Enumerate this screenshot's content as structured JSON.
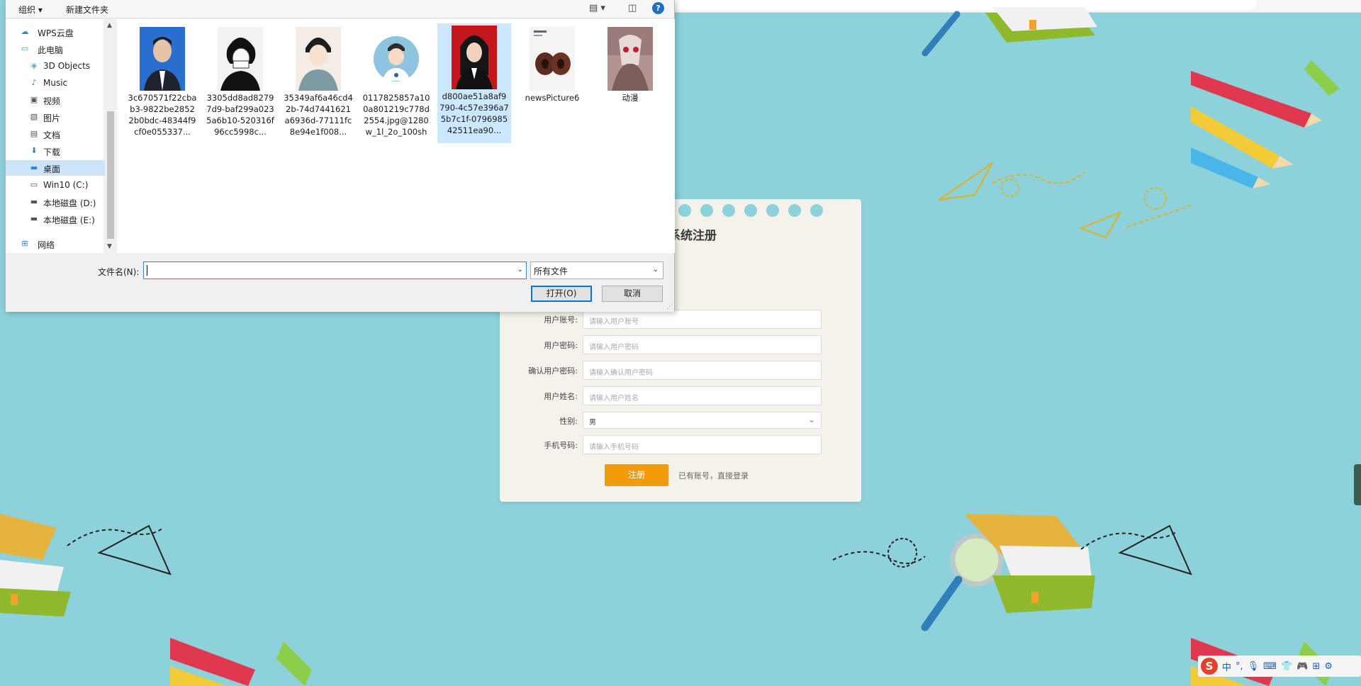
{
  "dialog": {
    "toolbar": {
      "organize_label": "组织 ▾",
      "new_folder_label": "新建文件夹",
      "view_icon": "view-options-icon",
      "pane_icon": "preview-pane-icon",
      "help_label": "?"
    },
    "nav": [
      {
        "label": "WPS云盘",
        "icon": "cloud-icon"
      },
      {
        "label": "此电脑",
        "icon": "computer-icon"
      },
      {
        "label": "3D Objects",
        "icon": "3d-objects-icon"
      },
      {
        "label": "Music",
        "icon": "music-icon"
      },
      {
        "label": "视频",
        "icon": "video-icon"
      },
      {
        "label": "图片",
        "icon": "pictures-icon"
      },
      {
        "label": "文档",
        "icon": "documents-icon"
      },
      {
        "label": "下载",
        "icon": "download-icon"
      },
      {
        "label": "桌面",
        "icon": "desktop-icon"
      },
      {
        "label": "Win10 (C:)",
        "icon": "drive-icon"
      },
      {
        "label": "本地磁盘 (D:)",
        "icon": "drive-icon"
      },
      {
        "label": "本地磁盘 (E:)",
        "icon": "drive-icon"
      },
      {
        "label": "网络",
        "icon": "network-icon"
      }
    ],
    "files": [
      {
        "name": "3c670571f22cbab3-9822be28522b0bdc-48344f9cf0e055337..."
      },
      {
        "name": "3305dd8ad82797d9-baf299a0235a6b10-520316f96cc5998c..."
      },
      {
        "name": "35349af6a46cd42b-74d7441621a6936d-77111fc8e94e1f008..."
      },
      {
        "name": "0117825857a100a801219c778d2554.jpg@1280w_1l_2o_100sh"
      },
      {
        "name": "d800ae51a8af9790-4c57e396a75b7c1f-079698542511ea90..."
      },
      {
        "name": "newsPicture6"
      },
      {
        "name": "动漫"
      }
    ],
    "filename_label": "文件名(N):",
    "filename_value": "",
    "filter_value": "所有文件",
    "open_label": "打开(O)",
    "cancel_label": "取消"
  },
  "register": {
    "title": "饮食系统注册",
    "fields": [
      {
        "label": "用户账号:",
        "placeholder": "请输入用户账号"
      },
      {
        "label": "用户密码:",
        "placeholder": "请输入用户密码"
      },
      {
        "label": "确认用户密码:",
        "placeholder": "请输入确认用户密码"
      },
      {
        "label": "用户姓名:",
        "placeholder": "请输入用户姓名"
      },
      {
        "label": "性别:",
        "value": "男"
      },
      {
        "label": "手机号码:",
        "placeholder": "请输入手机号码"
      }
    ],
    "submit_label": "注册",
    "login_link": "已有账号，直接登录"
  },
  "tray": {
    "ime_label": "中",
    "punct_label": "°,",
    "sogou_label": "S"
  },
  "colors": {
    "background": "#8dd1db",
    "accent": "#f39c0b",
    "card": "#f5f2ec",
    "selection": "#cce8ff"
  }
}
